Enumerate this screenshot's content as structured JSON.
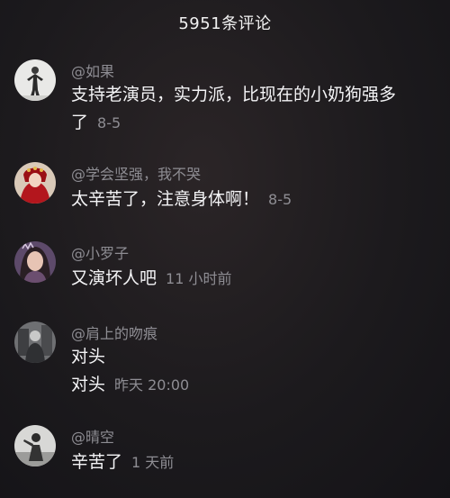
{
  "header": {
    "title": "5951条评论"
  },
  "comments": [
    {
      "username": "@如果",
      "text_line1": "支持老演员，实力派，比现在的小奶狗强多",
      "text_line2": "了",
      "time": "8-5",
      "avatar_icon": "statue-avatar-icon"
    },
    {
      "username": "@学会坚强，我不哭",
      "text": "太辛苦了，注意身体啊！",
      "time": "8-5",
      "avatar_icon": "woman-red-headdress-avatar-icon"
    },
    {
      "username": "@小罗子",
      "text": "又演坏人吧",
      "time": "11 小时前",
      "avatar_icon": "woman-portrait-avatar-icon"
    },
    {
      "username": "@肩上的吻痕",
      "text_line1": "对头",
      "text_line2": "对头",
      "time": "昨天 20:00",
      "avatar_icon": "grayscale-figure-avatar-icon"
    },
    {
      "username": "@晴空",
      "text": "辛苦了",
      "time": "1 天前",
      "avatar_icon": "silhouette-avatar-icon"
    }
  ]
}
